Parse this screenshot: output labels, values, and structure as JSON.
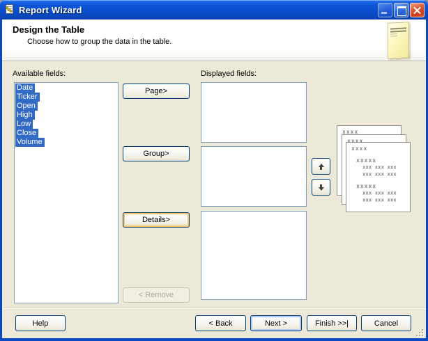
{
  "window": {
    "title": "Report Wizard"
  },
  "header": {
    "title": "Design the Table",
    "subtitle": "Choose how to group the data in the table."
  },
  "fields": {
    "available_label": "Available fields:",
    "available_items": [
      "Date",
      "Ticker",
      "Open",
      "High",
      "Low",
      "Close",
      "Volume"
    ],
    "displayed_label": "Displayed fields:"
  },
  "actions": {
    "page": "Page>",
    "group": "Group>",
    "details": "Details>",
    "remove": "< Remove"
  },
  "preview": {
    "back_header": "xxxx",
    "middle_header": "xxxx",
    "front_header": "xxxx",
    "group1_label": "xxxxx",
    "group1_row1": "xxx xxx xxx",
    "group1_row2": "xxx xxx xxx",
    "group2_label": "xxxxx",
    "group2_row1": "xxx xxx xxx",
    "group2_row2": "xxx xxx xxx"
  },
  "footer": {
    "help": "Help",
    "back": "< Back",
    "next": "Next >",
    "finish": "Finish >>|",
    "cancel": "Cancel"
  },
  "colors": {
    "titlebar_blue": "#0d55d8",
    "dialog_beige": "#ece9d8",
    "selection_blue": "#316ac5",
    "button_border": "#003c74",
    "focus_gold": "#f3c46a",
    "default_button_ring": "#aecbf7",
    "close_red": "#cc3c16"
  }
}
